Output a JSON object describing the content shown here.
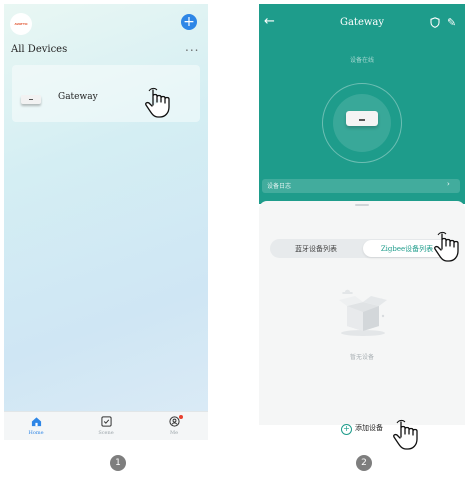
{
  "screen1": {
    "logo_text": "AVATTO",
    "title": "All Devices",
    "more_label": "...",
    "device_name": "Gateway",
    "tabs": [
      {
        "label": "Home",
        "icon": "home-icon",
        "active": true
      },
      {
        "label": "Scene",
        "icon": "scene-icon",
        "active": false
      },
      {
        "label": "Me",
        "icon": "me-icon",
        "active": false
      }
    ]
  },
  "screen2": {
    "title": "Gateway",
    "status": "设备在线",
    "log_label": "设备日志",
    "tab_bluetooth": "蓝牙设备列表",
    "tab_zigbee": "Zigbee设备列表",
    "empty_text": "暂无设备",
    "add_device": "添加设备"
  },
  "steps": [
    "1",
    "2"
  ],
  "colors": {
    "accent_blue": "#2e86e6",
    "teal": "#1e9c8b",
    "badge_red": "#e8402e"
  }
}
